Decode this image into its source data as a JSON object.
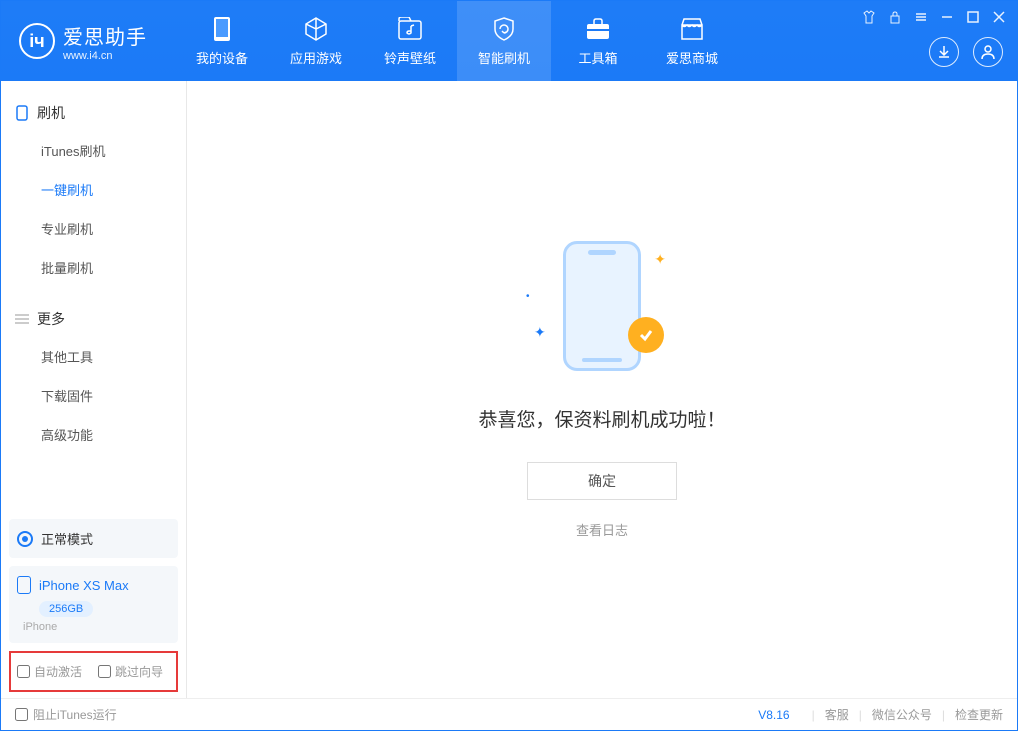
{
  "app": {
    "title": "爱思助手",
    "subtitle": "www.i4.cn"
  },
  "nav": {
    "tabs": [
      {
        "label": "我的设备"
      },
      {
        "label": "应用游戏"
      },
      {
        "label": "铃声壁纸"
      },
      {
        "label": "智能刷机"
      },
      {
        "label": "工具箱"
      },
      {
        "label": "爱思商城"
      }
    ]
  },
  "sidebar": {
    "section1": {
      "title": "刷机"
    },
    "items1": [
      {
        "label": "iTunes刷机"
      },
      {
        "label": "一键刷机"
      },
      {
        "label": "专业刷机"
      },
      {
        "label": "批量刷机"
      }
    ],
    "section2": {
      "title": "更多"
    },
    "items2": [
      {
        "label": "其他工具"
      },
      {
        "label": "下载固件"
      },
      {
        "label": "高级功能"
      }
    ],
    "status": {
      "label": "正常模式"
    },
    "device": {
      "name": "iPhone XS Max",
      "capacity": "256GB",
      "type": "iPhone"
    },
    "checks": {
      "auto_activate": "自动激活",
      "skip_guide": "跳过向导"
    }
  },
  "main": {
    "success_text": "恭喜您，保资料刷机成功啦！",
    "confirm": "确定",
    "view_log": "查看日志"
  },
  "footer": {
    "block_itunes": "阻止iTunes运行",
    "version": "V8.16",
    "support": "客服",
    "wechat": "微信公众号",
    "check_update": "检查更新"
  }
}
